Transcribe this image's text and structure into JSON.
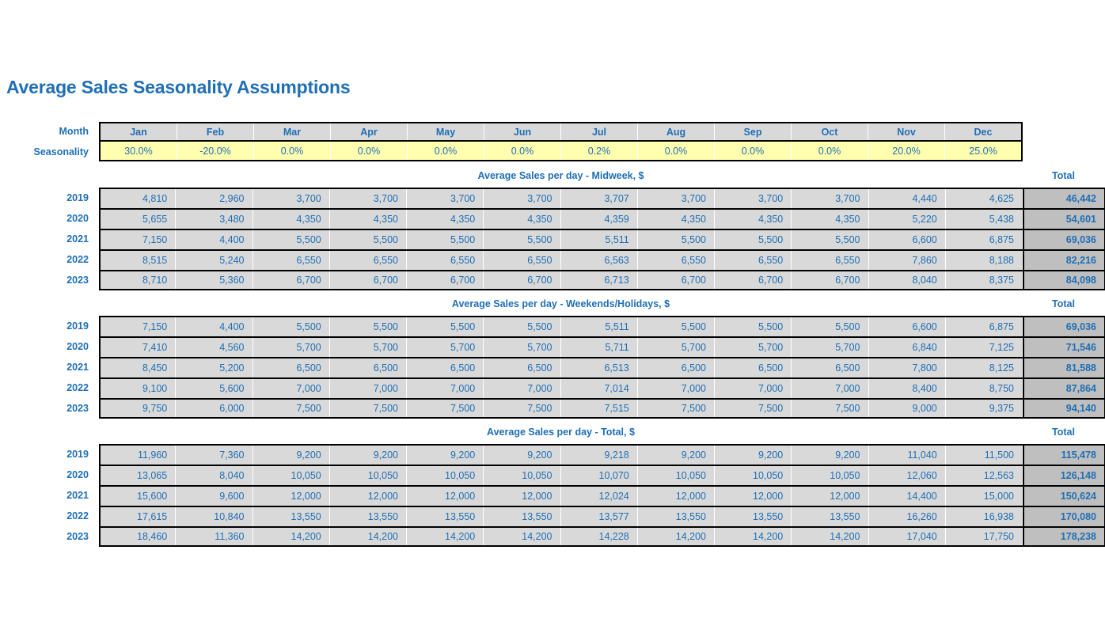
{
  "page": {
    "title": "Average Sales Seasonality Assumptions",
    "accent_color": "#1f6fb5",
    "header_fill": "#d9d9d9",
    "input_fill": "#ffffaf",
    "total_fill": "#bfbfbf"
  },
  "assumptions": {
    "month_label": "Month",
    "seasonality_label": "Seasonality",
    "months": [
      "Jan",
      "Feb",
      "Mar",
      "Apr",
      "May",
      "Jun",
      "Jul",
      "Aug",
      "Sep",
      "Oct",
      "Nov",
      "Dec"
    ],
    "seasonality": [
      "30.0%",
      "-20.0%",
      "0.0%",
      "0.0%",
      "0.0%",
      "0.0%",
      "0.2%",
      "0.0%",
      "0.0%",
      "0.0%",
      "20.0%",
      "25.0%"
    ]
  },
  "total_caption": "Total",
  "sections": [
    {
      "caption": "Average Sales per day - Midweek, $",
      "rows": [
        {
          "year": "2019",
          "values": [
            "4,810",
            "2,960",
            "3,700",
            "3,700",
            "3,700",
            "3,700",
            "3,707",
            "3,700",
            "3,700",
            "3,700",
            "4,440",
            "4,625"
          ],
          "total": "46,442"
        },
        {
          "year": "2020",
          "values": [
            "5,655",
            "3,480",
            "4,350",
            "4,350",
            "4,350",
            "4,350",
            "4,359",
            "4,350",
            "4,350",
            "4,350",
            "5,220",
            "5,438"
          ],
          "total": "54,601"
        },
        {
          "year": "2021",
          "values": [
            "7,150",
            "4,400",
            "5,500",
            "5,500",
            "5,500",
            "5,500",
            "5,511",
            "5,500",
            "5,500",
            "5,500",
            "6,600",
            "6,875"
          ],
          "total": "69,036"
        },
        {
          "year": "2022",
          "values": [
            "8,515",
            "5,240",
            "6,550",
            "6,550",
            "6,550",
            "6,550",
            "6,563",
            "6,550",
            "6,550",
            "6,550",
            "7,860",
            "8,188"
          ],
          "total": "82,216"
        },
        {
          "year": "2023",
          "values": [
            "8,710",
            "5,360",
            "6,700",
            "6,700",
            "6,700",
            "6,700",
            "6,713",
            "6,700",
            "6,700",
            "6,700",
            "8,040",
            "8,375"
          ],
          "total": "84,098"
        }
      ]
    },
    {
      "caption": "Average Sales per day -  Weekends/Holidays, $",
      "rows": [
        {
          "year": "2019",
          "values": [
            "7,150",
            "4,400",
            "5,500",
            "5,500",
            "5,500",
            "5,500",
            "5,511",
            "5,500",
            "5,500",
            "5,500",
            "6,600",
            "6,875"
          ],
          "total": "69,036"
        },
        {
          "year": "2020",
          "values": [
            "7,410",
            "4,560",
            "5,700",
            "5,700",
            "5,700",
            "5,700",
            "5,711",
            "5,700",
            "5,700",
            "5,700",
            "6,840",
            "7,125"
          ],
          "total": "71,546"
        },
        {
          "year": "2021",
          "values": [
            "8,450",
            "5,200",
            "6,500",
            "6,500",
            "6,500",
            "6,500",
            "6,513",
            "6,500",
            "6,500",
            "6,500",
            "7,800",
            "8,125"
          ],
          "total": "81,588"
        },
        {
          "year": "2022",
          "values": [
            "9,100",
            "5,600",
            "7,000",
            "7,000",
            "7,000",
            "7,000",
            "7,014",
            "7,000",
            "7,000",
            "7,000",
            "8,400",
            "8,750"
          ],
          "total": "87,864"
        },
        {
          "year": "2023",
          "values": [
            "9,750",
            "6,000",
            "7,500",
            "7,500",
            "7,500",
            "7,500",
            "7,515",
            "7,500",
            "7,500",
            "7,500",
            "9,000",
            "9,375"
          ],
          "total": "94,140"
        }
      ]
    },
    {
      "caption": "Average Sales per day - Total, $",
      "rows": [
        {
          "year": "2019",
          "values": [
            "11,960",
            "7,360",
            "9,200",
            "9,200",
            "9,200",
            "9,200",
            "9,218",
            "9,200",
            "9,200",
            "9,200",
            "11,040",
            "11,500"
          ],
          "total": "115,478"
        },
        {
          "year": "2020",
          "values": [
            "13,065",
            "8,040",
            "10,050",
            "10,050",
            "10,050",
            "10,050",
            "10,070",
            "10,050",
            "10,050",
            "10,050",
            "12,060",
            "12,563"
          ],
          "total": "126,148"
        },
        {
          "year": "2021",
          "values": [
            "15,600",
            "9,600",
            "12,000",
            "12,000",
            "12,000",
            "12,000",
            "12,024",
            "12,000",
            "12,000",
            "12,000",
            "14,400",
            "15,000"
          ],
          "total": "150,624"
        },
        {
          "year": "2022",
          "values": [
            "17,615",
            "10,840",
            "13,550",
            "13,550",
            "13,550",
            "13,550",
            "13,577",
            "13,550",
            "13,550",
            "13,550",
            "16,260",
            "16,938"
          ],
          "total": "170,080"
        },
        {
          "year": "2023",
          "values": [
            "18,460",
            "11,360",
            "14,200",
            "14,200",
            "14,200",
            "14,200",
            "14,228",
            "14,200",
            "14,200",
            "14,200",
            "17,040",
            "17,750"
          ],
          "total": "178,238"
        }
      ]
    }
  ]
}
